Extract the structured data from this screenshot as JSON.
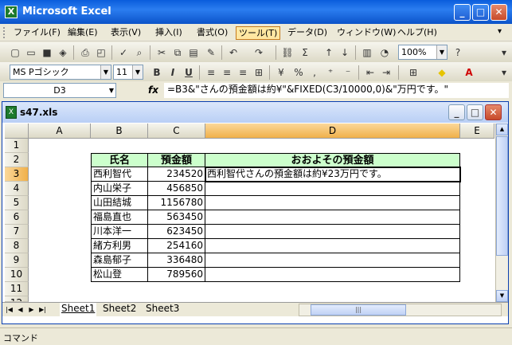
{
  "window": {
    "title": "Microsoft Excel",
    "min": "_",
    "max": "□",
    "close": "✕"
  },
  "menu": [
    {
      "label": "ファイル(F)"
    },
    {
      "label": "編集(E)"
    },
    {
      "label": "表示(V)"
    },
    {
      "label": "挿入(I)"
    },
    {
      "label": "書式(O)"
    },
    {
      "label": "ツール(T)"
    },
    {
      "label": "データ(D)"
    },
    {
      "label": "ウィンドウ(W)"
    },
    {
      "label": "ヘルプ(H)"
    }
  ],
  "toolbar": {
    "zoom": "100%",
    "font": "MS Pゴシック",
    "size": "11",
    "bold": "B",
    "italic": "I",
    "underline": "U",
    "percent": "%",
    "comma": ",",
    "autosum": "Σ"
  },
  "formula_bar": {
    "cell_ref": "D3",
    "fx": "fx",
    "formula": "=B3&\"さんの預金額は約¥\"&FIXED(C3/10000,0)&\"万円です。\""
  },
  "workbook": {
    "title": "s47.xls"
  },
  "columns": [
    "A",
    "B",
    "C",
    "D",
    "E"
  ],
  "rows": [
    "1",
    "2",
    "3",
    "4",
    "5",
    "6",
    "7",
    "8",
    "9",
    "10",
    "11",
    "12"
  ],
  "table": {
    "headers": {
      "name": "氏名",
      "amount": "預金額",
      "approx": "おおよその預金額"
    },
    "data": [
      {
        "name": "西利智代",
        "amount": "234520",
        "approx": "西利智代さんの預金額は約¥23万円です。"
      },
      {
        "name": "内山栄子",
        "amount": "456850",
        "approx": ""
      },
      {
        "name": "山田結城",
        "amount": "1156780",
        "approx": ""
      },
      {
        "name": "福島直也",
        "amount": "563450",
        "approx": ""
      },
      {
        "name": "川本洋一",
        "amount": "623450",
        "approx": ""
      },
      {
        "name": "緒方利男",
        "amount": "254160",
        "approx": ""
      },
      {
        "name": "森島郁子",
        "amount": "336480",
        "approx": ""
      },
      {
        "name": "松山登",
        "amount": "789560",
        "approx": ""
      }
    ]
  },
  "sheets": [
    "Sheet1",
    "Sheet2",
    "Sheet3"
  ],
  "status": "コマンド"
}
